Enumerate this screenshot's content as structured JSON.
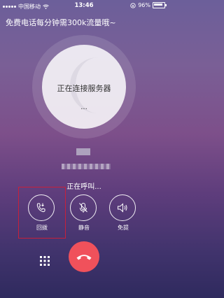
{
  "status_bar": {
    "carrier": "中国移动",
    "time": "13:46",
    "battery": "96%"
  },
  "banner": {
    "text": "免费电话每分钟需300k流量哦~"
  },
  "connect": {
    "status": "正在连接服务器",
    "dots": "..."
  },
  "call": {
    "status": "正在呼叫..."
  },
  "controls": [
    {
      "label": "回拨",
      "icon": "redial-phone-icon"
    },
    {
      "label": "静音",
      "icon": "mute-mic-icon"
    },
    {
      "label": "免提",
      "icon": "speaker-icon"
    }
  ],
  "colors": {
    "hangup": "#f0515b",
    "highlight": "#c7203b"
  }
}
